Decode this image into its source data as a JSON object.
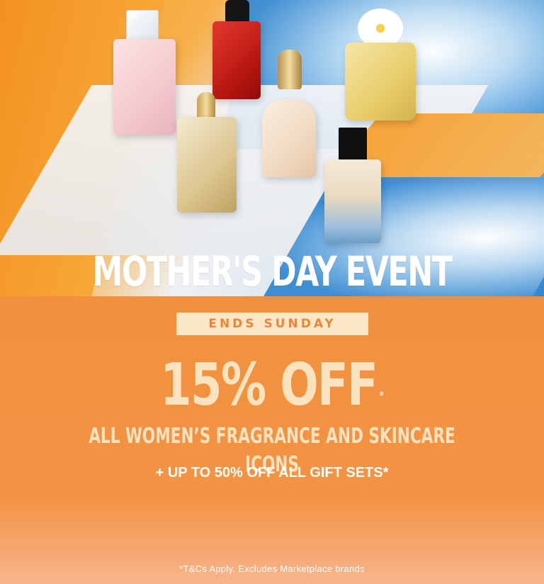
{
  "hero": {
    "headline": "MOTHER'S DAY EVENT"
  },
  "promo": {
    "badge": "ENDS SUNDAY",
    "discount": "15% OFF",
    "discount_marker": "*",
    "subheading": "ALL WOMEN’S FRAGRANCE AND SKINCARE ICONS",
    "extra_offer": "+ UP TO 50% OFF ALL GIFT SETS*",
    "terms": "*T&Cs Apply. Excludes Marketplace brands"
  },
  "colors": {
    "panel_orange": "#f2903e",
    "badge_bg": "#fbe6c8",
    "badge_text": "#e8873e",
    "headline_text": "#ffffff",
    "offer_text": "#fbe3c0"
  }
}
